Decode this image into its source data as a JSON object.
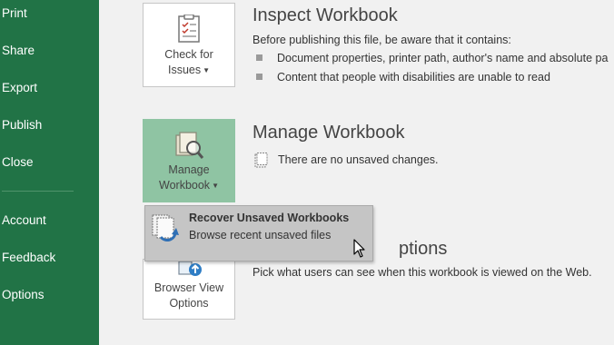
{
  "sidebar": {
    "items": [
      {
        "label": "Print"
      },
      {
        "label": "Share"
      },
      {
        "label": "Export"
      },
      {
        "label": "Publish"
      },
      {
        "label": "Close"
      },
      {
        "label": "Account"
      },
      {
        "label": "Feedback"
      },
      {
        "label": "Options"
      }
    ]
  },
  "inspect": {
    "button_line1": "Check for",
    "button_line2": "Issues",
    "title": "Inspect Workbook",
    "description": "Before publishing this file, be aware that it contains:",
    "bullets": [
      "Document properties, printer path, author's name and absolute pa",
      "Content that people with disabilities are unable to read"
    ]
  },
  "manage": {
    "button_line1": "Manage",
    "button_line2": "Workbook",
    "title": "Manage Workbook",
    "status": "There are no unsaved changes."
  },
  "browser": {
    "button_line1": "Browser View",
    "button_line2": "Options",
    "title_partial": "ptions",
    "description": "Pick what users can see when this workbook is viewed on the Web."
  },
  "dropdown": {
    "item_title": "Recover Unsaved Workbooks",
    "item_desc": "Browse recent unsaved files"
  },
  "colors": {
    "sidebar_bg": "#217346",
    "selected_button_bg": "#8fc4a3",
    "dropdown_bg": "#c5c5c5"
  },
  "icons": {
    "inspect": "check-for-issues-icon",
    "manage": "manage-workbook-icon",
    "recover": "recover-files-icon",
    "browser": "browser-view-icon",
    "status": "document-icon"
  }
}
